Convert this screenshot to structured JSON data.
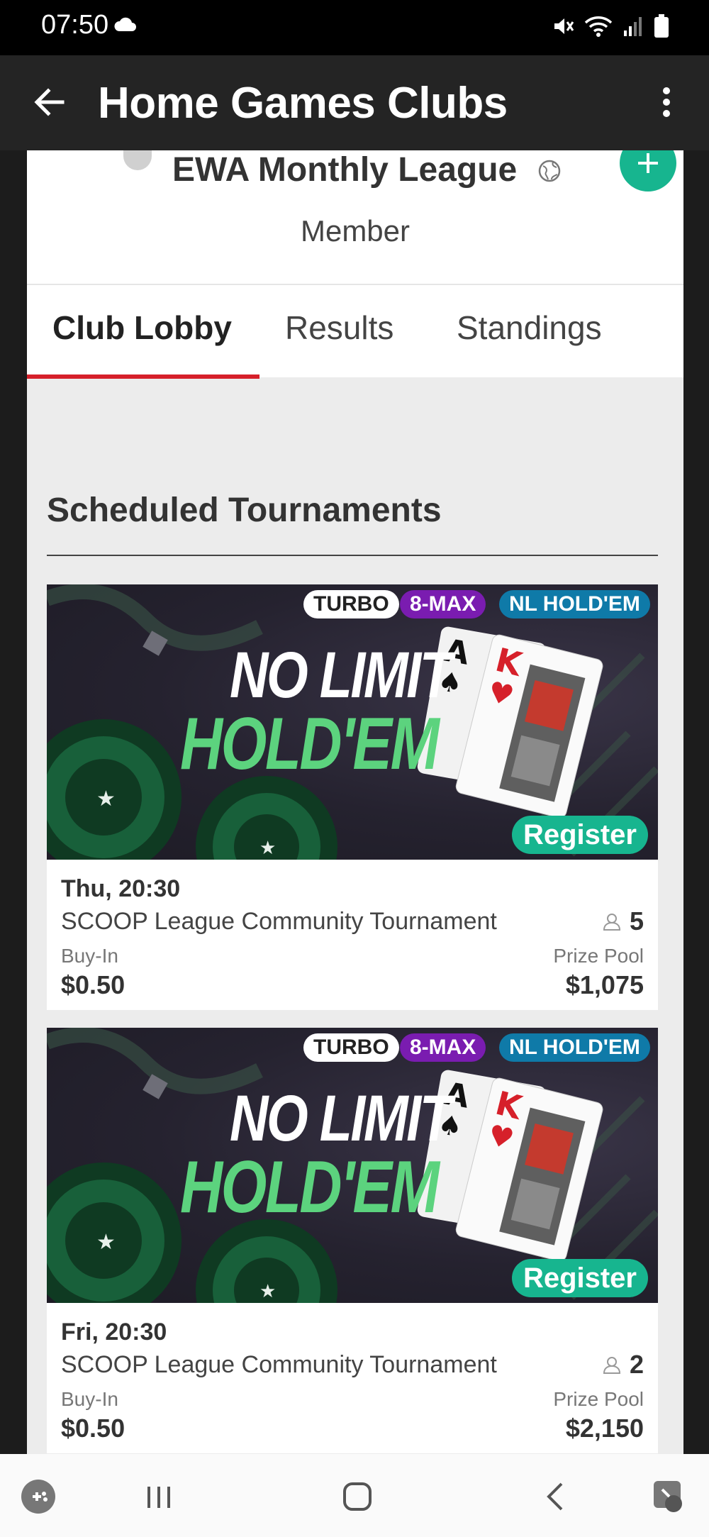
{
  "status_bar": {
    "time": "07:50",
    "icons": [
      "cloud-icon",
      "mute-icon",
      "wifi-icon",
      "signal-icon",
      "battery-icon"
    ]
  },
  "app_bar": {
    "title": "Home Games Clubs",
    "back_icon": "arrow-left-icon",
    "menu_icon": "more-vert-icon"
  },
  "club": {
    "name": "EWA Monthly League",
    "role": "Member",
    "visibility_icon": "globe-icon",
    "add_icon": "plus-icon"
  },
  "tabs": [
    {
      "label": "Club Lobby",
      "active": true
    },
    {
      "label": "Results",
      "active": false
    },
    {
      "label": "Standings",
      "active": false
    }
  ],
  "section_title": "Scheduled Tournaments",
  "tournaments": [
    {
      "tags": [
        "TURBO",
        "8-MAX",
        "NL HOLD'EM"
      ],
      "banner_line1": "NO LIMIT",
      "banner_line2": "HOLD'EM",
      "register_label": "Register",
      "time": "Thu, 20:30",
      "name": "SCOOP League Community Tournament",
      "players": "5",
      "buyin_label": "Buy-In",
      "buyin": "$0.50",
      "prize_label": "Prize Pool",
      "prize": "$1,075"
    },
    {
      "tags": [
        "TURBO",
        "8-MAX",
        "NL HOLD'EM"
      ],
      "banner_line1": "NO LIMIT",
      "banner_line2": "HOLD'EM",
      "register_label": "Register",
      "time": "Fri, 20:30",
      "name": "SCOOP League Community Tournament",
      "players": "2",
      "buyin_label": "Buy-In",
      "buyin": "$0.50",
      "prize_label": "Prize Pool",
      "prize": "$2,150"
    }
  ],
  "bottom_nav": [
    "game-launcher-icon",
    "recent-apps-icon",
    "home-icon",
    "back-icon",
    "accessibility-icon"
  ],
  "colors": {
    "accent_red": "#d6202a",
    "accent_green": "#17b58f",
    "app_bar": "#242424"
  }
}
